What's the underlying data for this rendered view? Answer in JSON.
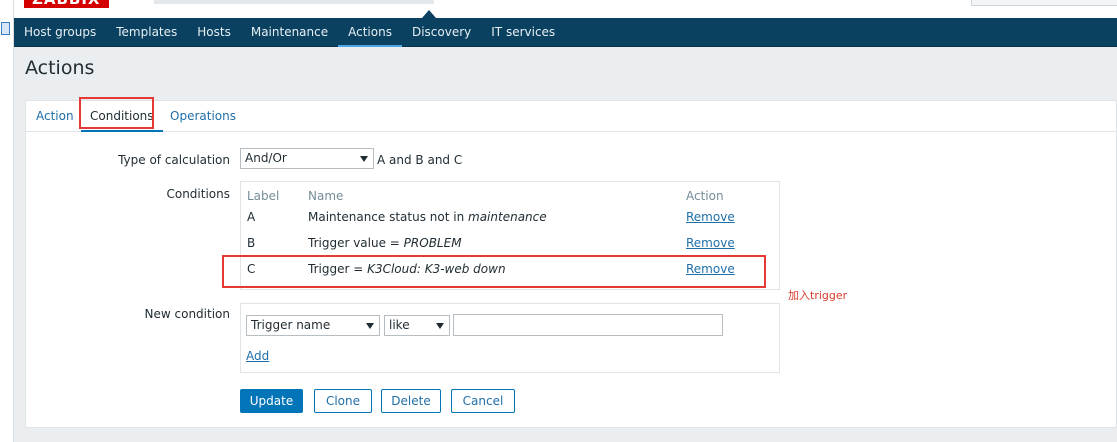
{
  "brand": {
    "logo_text": "ZABBIX"
  },
  "nav": {
    "items": [
      {
        "label": "Host groups"
      },
      {
        "label": "Templates"
      },
      {
        "label": "Hosts"
      },
      {
        "label": "Maintenance"
      },
      {
        "label": "Actions",
        "active": true
      },
      {
        "label": "Discovery"
      },
      {
        "label": "IT services"
      }
    ]
  },
  "page": {
    "title": "Actions"
  },
  "tabs": [
    {
      "label": "Action"
    },
    {
      "label": "Conditions",
      "active": true
    },
    {
      "label": "Operations"
    }
  ],
  "calc": {
    "label": "Type of calculation",
    "selected": "And/Or",
    "formula": "A and B and C"
  },
  "conditions": {
    "label": "Conditions",
    "headers": {
      "label": "Label",
      "name": "Name",
      "action": "Action"
    },
    "rows": [
      {
        "label": "A",
        "name_prefix": "Maintenance status not in ",
        "name_value": "maintenance",
        "action": "Remove"
      },
      {
        "label": "B",
        "name_prefix": "Trigger value = ",
        "name_value": "PROBLEM",
        "action": "Remove"
      },
      {
        "label": "C",
        "name_prefix": "Trigger = ",
        "name_value": "K3Cloud: K3-web down",
        "action": "Remove"
      }
    ]
  },
  "annotation": {
    "text": "加入trigger"
  },
  "new_condition": {
    "label": "New condition",
    "type_selected": "Trigger name",
    "operator_selected": "like",
    "value": "",
    "add_label": "Add"
  },
  "buttons": {
    "update": "Update",
    "clone": "Clone",
    "delete": "Delete",
    "cancel": "Cancel"
  },
  "colors": {
    "nav_bg": "#0b4160",
    "accent": "#0275b8",
    "highlight": "#e53935",
    "link": "#1f6fa8"
  }
}
